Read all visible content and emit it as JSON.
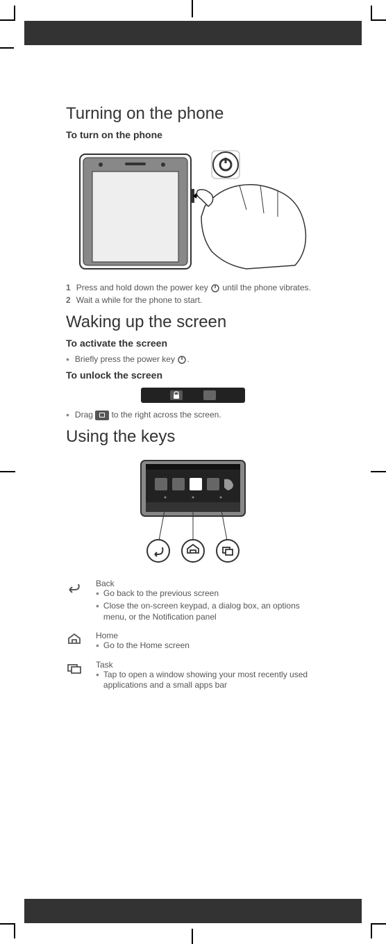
{
  "sections": {
    "turning_on": {
      "heading": "Turning on the phone",
      "subheading": "To turn on the phone",
      "steps": [
        {
          "num": "1",
          "text_before": "Press and hold down the power key ",
          "text_after": " until the phone vibrates."
        },
        {
          "num": "2",
          "text_before": "Wait a while for the phone to start.",
          "text_after": ""
        }
      ]
    },
    "waking_up": {
      "heading": "Waking up the screen",
      "activate_subheading": "To activate the screen",
      "activate_bullet_before": "Briefly press the power key ",
      "activate_bullet_after": ".",
      "unlock_subheading": "To unlock the screen",
      "drag_before": "Drag ",
      "drag_after": " to the right across the screen."
    },
    "using_keys": {
      "heading": "Using the keys",
      "keys": [
        {
          "name": "Back",
          "bullets": [
            "Go back to the previous screen",
            "Close the on-screen keypad, a dialog box, an options menu, or the Notification panel"
          ]
        },
        {
          "name": "Home",
          "bullets": [
            "Go to the Home screen"
          ]
        },
        {
          "name": "Task",
          "bullets": [
            "Tap to open a window showing your most recently used applications and a small apps bar"
          ]
        }
      ]
    }
  }
}
